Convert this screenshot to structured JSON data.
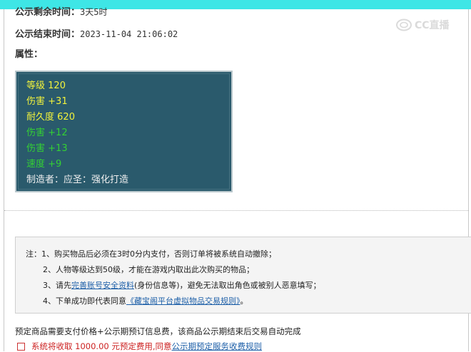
{
  "remain": {
    "label": "公示剩余时间：",
    "value": "3天5时"
  },
  "end": {
    "label": "公示结束时间：",
    "value": "2023-11-04 21:06:02"
  },
  "attr_label": "属性：",
  "watermark": {
    "text": "CC直播",
    "icon": "cc-logo-icon"
  },
  "stats": [
    {
      "name": "等级",
      "value": "120",
      "color": "yellow"
    },
    {
      "name": "伤害",
      "value": "+31",
      "color": "yellow"
    },
    {
      "name": "耐久度",
      "value": "620",
      "color": "yellow"
    },
    {
      "name": "伤害",
      "value": "+12",
      "color": "green"
    },
    {
      "name": "伤害",
      "value": "+13",
      "color": "green"
    },
    {
      "name": "速度",
      "value": "+9",
      "color": "green"
    },
    {
      "name": "制造者：应圣：强化打造",
      "value": "",
      "color": "white"
    }
  ],
  "notice": {
    "prefix": "注：",
    "line1": "1、购买物品后必须在3时0分内支付，否则订单将被系统自动撤除；",
    "line2": "2、人物等级达到50级，才能在游戏内取出此次购买的物品；",
    "line3_pre": "3、请先",
    "line3_link": "完善账号安全资料",
    "line3_post": "(身份信息等)，避免无法取出角色或被别人恶意填写；",
    "line4_pre": "4、下单成功即代表同意",
    "line4_link": "《藏宝阁平台虚拟物品交易规则》",
    "line4_post": "。"
  },
  "fee_text": "预定商品需要支付价格+公示期预订信息费，该商品公示期结束后交易自动完成",
  "agree": {
    "pre": "系统将收取 1000.00 元预定费用,同意",
    "link": "公示期预定服务收费规则",
    "checked": false
  },
  "colors": {
    "topbar": "#3ee6e6",
    "stats_bg": "#2a5a6c",
    "yellow": "#f2f23c",
    "green": "#34d034",
    "link": "#1d5fa8"
  }
}
